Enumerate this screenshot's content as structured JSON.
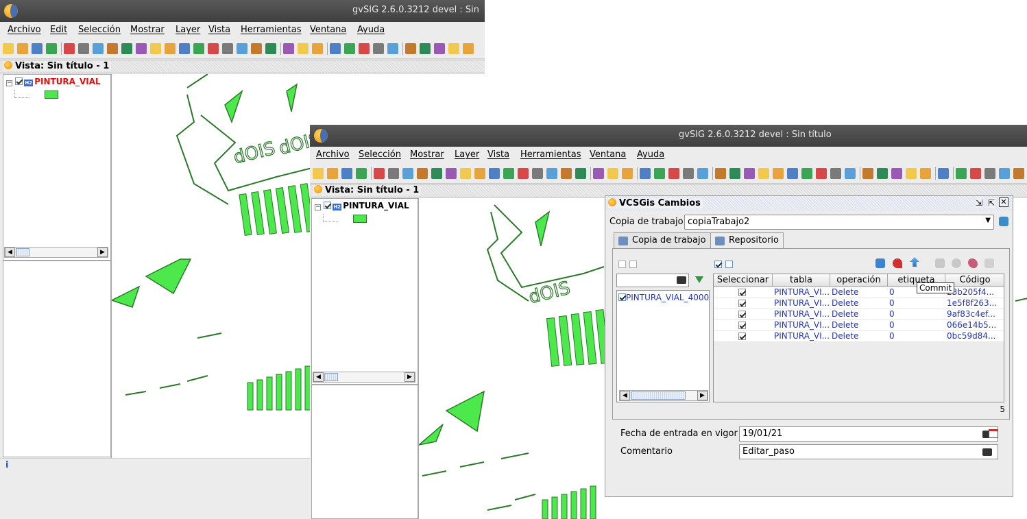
{
  "back_window": {
    "title": "gvSIG 2.6.0.3212 devel : Sin",
    "menu": [
      "Archivo",
      "Edit",
      "Selección",
      "Mostrar",
      "Layer",
      "Vista",
      "Herramientas",
      "Ventana",
      "Ayuda"
    ],
    "view_title": "Vista: Sin título - 1",
    "layer_name": "PINTURA_VIAL",
    "status_text": "i"
  },
  "front_window": {
    "title": "gvSIG 2.6.0.3212 devel : Sin título",
    "menu": [
      "Archivo",
      "Selección",
      "Mostrar",
      "Layer",
      "Vista",
      "Herramientas",
      "Ventana",
      "Ayuda"
    ],
    "view_title": "Vista: Sin título - 1",
    "layer_name": "PINTURA_VIAL"
  },
  "map_labels": {
    "stop1": "dOIS",
    "stop2": "dOIS"
  },
  "dialog": {
    "title": "VCSGis Cambios",
    "working_copy_label": "Copia de trabajo",
    "working_copy_value": "copiaTrabajo2",
    "tabs": [
      "Copia de trabajo",
      "Repositorio"
    ],
    "list_items": [
      "PINTURA_VIAL_4000"
    ],
    "columns": [
      "Seleccionar",
      "tabla",
      "operación",
      "etiqueta",
      "Código"
    ],
    "rows": [
      {
        "tabla": "PINTURA_VI...",
        "operacion": "Delete",
        "etiqueta": "0",
        "codigo": "23b205f4..."
      },
      {
        "tabla": "PINTURA_VI...",
        "operacion": "Delete",
        "etiqueta": "0",
        "codigo": "1e5f8f263..."
      },
      {
        "tabla": "PINTURA_VI...",
        "operacion": "Delete",
        "etiqueta": "0",
        "codigo": "9af83c4ef..."
      },
      {
        "tabla": "PINTURA_VI...",
        "operacion": "Delete",
        "etiqueta": "0",
        "codigo": "066e14b5..."
      },
      {
        "tabla": "PINTURA_VI...",
        "operacion": "Delete",
        "etiqueta": "0",
        "codigo": "0bc59d84..."
      }
    ],
    "row_count": "5",
    "tooltip": "Commit",
    "date_label": "Fecha de entrada en vigor",
    "date_value": "19/01/21",
    "comment_label": "Comentario",
    "comment_value": "Editar_paso"
  },
  "colors": {
    "feature_fill": "#4ce84c",
    "title_bar": "#4a4a4a",
    "link_blue": "#2233cc",
    "layer_red": "#e01010"
  }
}
